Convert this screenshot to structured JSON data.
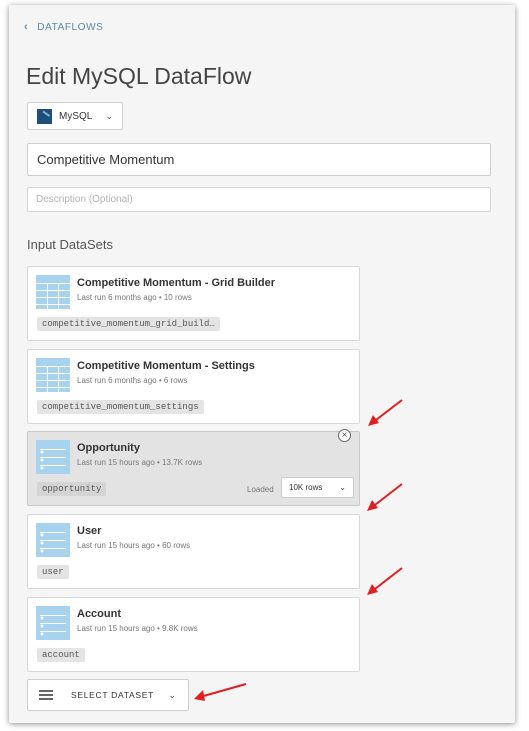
{
  "nav": {
    "back_label": "DATAFLOWS"
  },
  "page": {
    "title": "Edit MySQL DataFlow"
  },
  "connector_dropdown": {
    "label": "MySQL"
  },
  "form": {
    "name_value": "Competitive Momentum",
    "description_placeholder": "Description (Optional)"
  },
  "input_section": {
    "title": "Input DataSets"
  },
  "datasets": [
    {
      "name": "Competitive Momentum - Grid Builder",
      "meta": "Last run 6 months ago • 10 rows",
      "tag": "competitive_momentum_grid_build…",
      "icon": "grid-table-icon"
    },
    {
      "name": "Competitive Momentum - Settings",
      "meta": "Last run 6 months ago • 6 rows",
      "tag": "competitive_momentum_settings",
      "icon": "grid-table-icon"
    },
    {
      "name": "Opportunity",
      "meta": "Last run 15 hours ago • 13.7K rows",
      "tag": "opportunity",
      "icon": "list-table-icon",
      "loaded_label": "Loaded",
      "rows_option": "10K rows"
    },
    {
      "name": "User",
      "meta": "Last run 15 hours ago • 60 rows",
      "tag": "user",
      "icon": "list-table-icon"
    },
    {
      "name": "Account",
      "meta": "Last run 15 hours ago • 9.8K rows",
      "tag": "account",
      "icon": "list-table-icon"
    }
  ],
  "select_dataset": {
    "label": "SELECT DATASET"
  },
  "colors": {
    "accent": "#5b88a8",
    "icon_fill": "#a8d3ee",
    "annotation_arrow": "#e02020"
  }
}
